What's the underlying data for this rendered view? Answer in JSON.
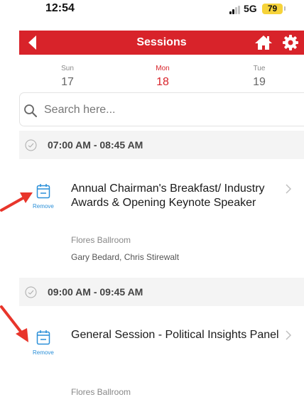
{
  "status_bar": {
    "time": "12:54",
    "network": "5G",
    "battery": "79"
  },
  "header": {
    "title": "Sessions",
    "back_icon": "back-arrow-icon",
    "home_icon": "home-icon",
    "settings_icon": "gear-icon"
  },
  "colors": {
    "brand_red": "#d8232a",
    "accent_blue": "#2a8fd8",
    "battery_yellow": "#f6d33a"
  },
  "days": [
    {
      "name": "Sun",
      "number": "17",
      "active": false
    },
    {
      "name": "Mon",
      "number": "18",
      "active": true
    },
    {
      "name": "Tue",
      "number": "19",
      "active": false
    }
  ],
  "search": {
    "placeholder": "Search here..."
  },
  "time_slots": [
    {
      "time": "07:00 AM - 08:45 AM"
    },
    {
      "time": "09:00 AM - 09:45 AM"
    }
  ],
  "sessions": [
    {
      "title": "Annual Chairman's Breakfast/ Industry Awards & Opening Keynote Speaker",
      "location": "Flores Ballroom",
      "speakers": "Gary Bedard, Chris Stirewalt",
      "action_label": "Remove"
    },
    {
      "title": "General Session - Political Insights Panel",
      "location": "Flores Ballroom",
      "action_label": "Remove"
    }
  ]
}
